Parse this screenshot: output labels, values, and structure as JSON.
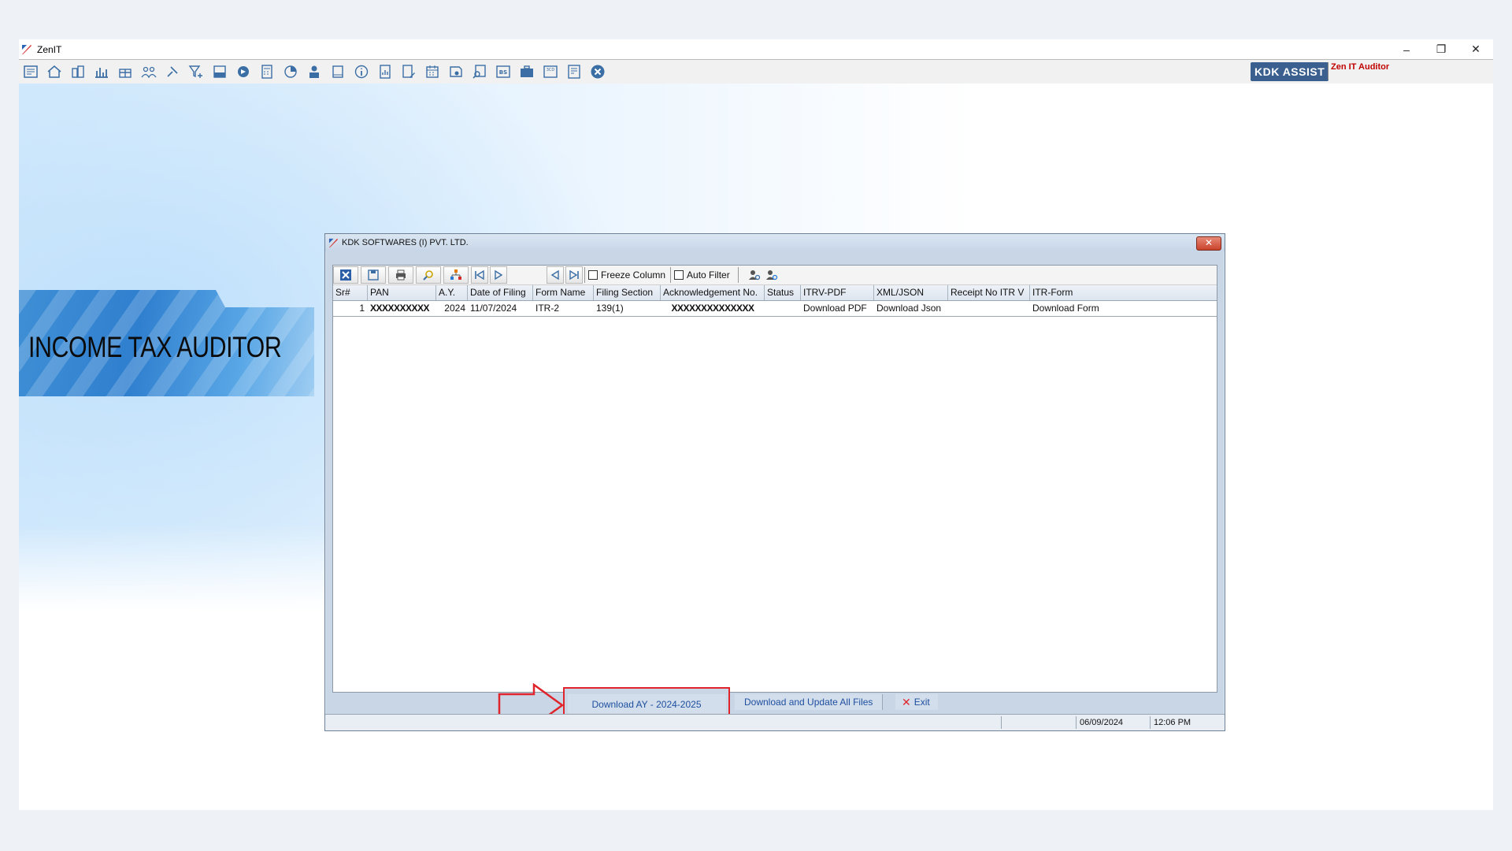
{
  "app": {
    "title": "ZenIT",
    "window_buttons": {
      "minimize": "–",
      "restore": "❐",
      "close": "✕"
    },
    "brand_assist": "KDK ASSIST",
    "brand_auditor": "Zen IT Auditor",
    "toolbar_icons": [
      "menu-book-icon",
      "home-icon",
      "buildings-icon",
      "bar-chart-icon",
      "gift-box-icon",
      "users-group-icon",
      "pin-icon",
      "filter-add-icon",
      "tax-icon",
      "tags-icon",
      "calculator-icon",
      "pie-chart-icon",
      "user-pay-icon",
      "book-icon",
      "info-icon",
      "report-icon",
      "document-edit-icon",
      "calendar-icon",
      "certificate-icon",
      "document-search-icon",
      "bs-icon",
      "briefcase-icon",
      "scd-icon",
      "ledger-icon",
      "close-circle-icon"
    ],
    "accent_color": "#3b5f8f"
  },
  "banner": {
    "title": "INCOME TAX AUDITOR"
  },
  "dialog": {
    "title": "KDK SOFTWARES (I) PVT. LTD.",
    "close_label": "✕",
    "toolbar": {
      "freeze_column": "Freeze Column",
      "auto_filter": "Auto Filter"
    },
    "table": {
      "headers": [
        "Sr#",
        "PAN",
        "A.Y.",
        "Date of Filing",
        "Form Name",
        "Filing Section",
        "Acknowledgement No.",
        "Status",
        "ITRV-PDF",
        "XML/JSON",
        "Receipt No ITR V",
        "ITR-Form"
      ],
      "rows": [
        {
          "sr": "1",
          "pan": "XXXXXXXXXX",
          "ay": "2024",
          "date": "11/07/2024",
          "form": "ITR-2",
          "section": "139(1)",
          "ack": "XXXXXXXXXXXXXX",
          "status": "",
          "itrv": "Download PDF",
          "xml": "Download Json",
          "receipt": "",
          "itr_form": "Download Form"
        }
      ]
    },
    "footer": {
      "download_ay": "Download AY - 2024-2025",
      "download_update_all": "Download and Update All Files",
      "exit": "Exit",
      "exit_icon": "✕"
    },
    "status": {
      "date": "06/09/2024",
      "time": "12:06 PM"
    },
    "highlight_color": "#e0242b"
  }
}
